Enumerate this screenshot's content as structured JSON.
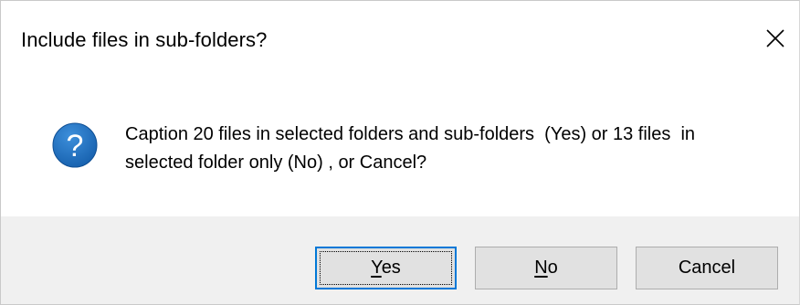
{
  "dialog": {
    "title": "Include files in sub-folders?",
    "close_icon": "close-icon",
    "message_line1": "Caption 20 files in selected folders and sub-folders  (Yes) or 13 files  in",
    "message_line2": "selected folder only (No) , or Cancel?",
    "icon": "question-icon",
    "icon_color": "#1e6dbb"
  },
  "buttons": {
    "yes": {
      "mnemonic": "Y",
      "rest": "es",
      "default": true
    },
    "no": {
      "mnemonic": "N",
      "rest": "o"
    },
    "cancel": {
      "label": "Cancel"
    }
  },
  "colors": {
    "footer_bg": "#f0f0f0",
    "button_bg": "#e1e1e1",
    "default_button_border": "#0078d7"
  }
}
